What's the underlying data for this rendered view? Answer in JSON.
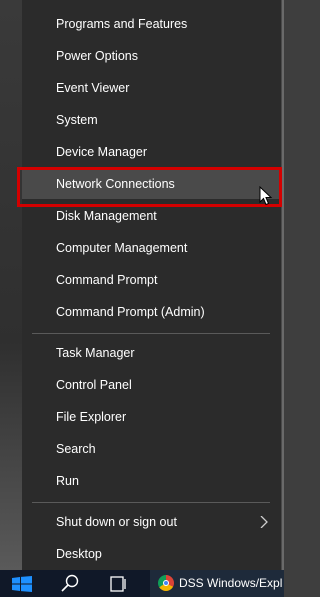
{
  "menu": {
    "items": [
      {
        "label": "Programs and Features"
      },
      {
        "label": "Power Options"
      },
      {
        "label": "Event Viewer"
      },
      {
        "label": "System"
      },
      {
        "label": "Device Manager"
      },
      {
        "label": "Network Connections"
      },
      {
        "label": "Disk Management"
      },
      {
        "label": "Computer Management"
      },
      {
        "label": "Command Prompt"
      },
      {
        "label": "Command Prompt (Admin)"
      },
      {
        "label": "Task Manager"
      },
      {
        "label": "Control Panel"
      },
      {
        "label": "File Explorer"
      },
      {
        "label": "Search"
      },
      {
        "label": "Run"
      },
      {
        "label": "Shut down or sign out"
      },
      {
        "label": "Desktop"
      }
    ],
    "highlighted_item": "Network Connections"
  },
  "taskbar": {
    "app_label": "DSS Windows/Expl"
  },
  "colors": {
    "menu_bg": "#2b2b2b",
    "hover_bg": "#4a4a4a",
    "highlight_border": "#d40000",
    "start_button": "#1e90ff"
  },
  "icons": {
    "start": "windows-start-icon",
    "search": "search-icon",
    "task_view": "task-view-icon",
    "submenu": "chevron-right-icon",
    "cursor": "mouse-cursor-icon",
    "app": "chrome-icon"
  }
}
